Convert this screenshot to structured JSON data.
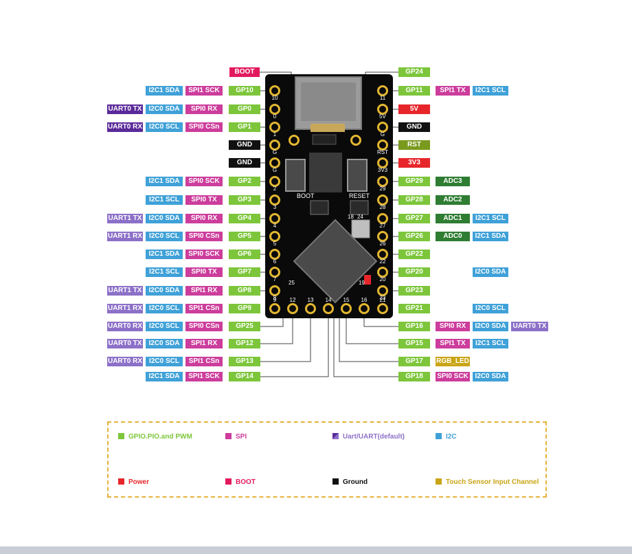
{
  "board": {
    "pad_numbers_left": [
      "10",
      "0",
      "1",
      "G",
      "G",
      "2",
      "3",
      "4",
      "5",
      "6",
      "7",
      "8"
    ],
    "pad_numbers_right": [
      "11",
      "5V",
      "G",
      "RST",
      "3V3",
      "29",
      "28",
      "27",
      "26",
      "22",
      "20",
      "23"
    ],
    "pad_numbers_bottom": [
      "9",
      "12",
      "13",
      "14",
      "15",
      "16",
      "21"
    ],
    "marks": {
      "boot": "BOOT",
      "reset": "RESET",
      "n18": "18",
      "n24": "24",
      "n25": "25",
      "n19": "19"
    }
  },
  "pins_left": [
    {
      "pin": "GP10",
      "tags": [
        {
          "t": "I2C1 SDA",
          "c": "i2c"
        },
        {
          "t": "SPI1 SCK",
          "c": "spi"
        }
      ]
    },
    {
      "pin": "GP0",
      "tags": [
        {
          "t": "UART0 TX",
          "c": "uart"
        },
        {
          "t": "I2C0 SDA",
          "c": "i2c"
        },
        {
          "t": "SPI0 RX",
          "c": "spi"
        }
      ]
    },
    {
      "pin": "GP1",
      "tags": [
        {
          "t": "UART0 RX",
          "c": "uart"
        },
        {
          "t": "I2C0 SCL",
          "c": "i2c"
        },
        {
          "t": "SPI0 CSn",
          "c": "spi"
        }
      ]
    },
    {
      "pin": "GND",
      "kind": "gnd",
      "tags": []
    },
    {
      "pin": "GND",
      "kind": "gnd",
      "tags": []
    },
    {
      "pin": "GP2",
      "tags": [
        {
          "t": "I2C1 SDA",
          "c": "i2c"
        },
        {
          "t": "SPI0 SCK",
          "c": "spi"
        }
      ]
    },
    {
      "pin": "GP3",
      "tags": [
        {
          "t": "I2C1 SCL",
          "c": "i2c"
        },
        {
          "t": "SPI0 TX",
          "c": "spi"
        }
      ]
    },
    {
      "pin": "GP4",
      "tags": [
        {
          "t": "UART1 TX",
          "c": "uartl"
        },
        {
          "t": "I2C0 SDA",
          "c": "i2c"
        },
        {
          "t": "SPI0 RX",
          "c": "spi"
        }
      ]
    },
    {
      "pin": "GP5",
      "tags": [
        {
          "t": "UART1 RX",
          "c": "uartl"
        },
        {
          "t": "I2C0 SCL",
          "c": "i2c"
        },
        {
          "t": "SPI0 CSn",
          "c": "spi"
        }
      ]
    },
    {
      "pin": "GP6",
      "tags": [
        {
          "t": "I2C1 SDA",
          "c": "i2c"
        },
        {
          "t": "SPI0 SCK",
          "c": "spi"
        }
      ]
    },
    {
      "pin": "GP7",
      "tags": [
        {
          "t": "I2C1 SCL",
          "c": "i2c"
        },
        {
          "t": "SPI0 TX",
          "c": "spi"
        }
      ]
    },
    {
      "pin": "GP8",
      "tags": [
        {
          "t": "UART1 TX",
          "c": "uartl"
        },
        {
          "t": "I2C0 SDA",
          "c": "i2c"
        },
        {
          "t": "SPI1 RX",
          "c": "spi"
        }
      ]
    },
    {
      "pin": "GP9",
      "tags": [
        {
          "t": "UART1 RX",
          "c": "uartl"
        },
        {
          "t": "I2C0 SCL",
          "c": "i2c"
        },
        {
          "t": "SPI1 CSn",
          "c": "spi"
        }
      ]
    },
    {
      "pin": "GP25",
      "tags": [
        {
          "t": "UART0 RX",
          "c": "uartl"
        },
        {
          "t": "I2C0 SCL",
          "c": "i2c"
        },
        {
          "t": "SPI0 CSn",
          "c": "spi"
        }
      ]
    },
    {
      "pin": "GP12",
      "tags": [
        {
          "t": "UART0 TX",
          "c": "uartl"
        },
        {
          "t": "I2C0 SDA",
          "c": "i2c"
        },
        {
          "t": "SPI1 RX",
          "c": "spi"
        }
      ]
    },
    {
      "pin": "GP13",
      "tags": [
        {
          "t": "UART0 RX",
          "c": "uartl"
        },
        {
          "t": "I2C0 SCL",
          "c": "i2c"
        },
        {
          "t": "SPI1 CSn",
          "c": "spi"
        }
      ]
    },
    {
      "pin": "GP14",
      "tags": [
        {
          "t": "I2C1 SDA",
          "c": "i2c"
        },
        {
          "t": "SPI1 SCK",
          "c": "spi"
        }
      ]
    }
  ],
  "pins_right": [
    {
      "pin": "GP24",
      "tags": []
    },
    {
      "pin": "GP11",
      "tags": [
        {
          "t": "SPI1 TX",
          "c": "spi"
        },
        {
          "t": "I2C1 SCL",
          "c": "i2c"
        }
      ]
    },
    {
      "pin": "5V",
      "kind": "power",
      "tags": []
    },
    {
      "pin": "GND",
      "kind": "gnd",
      "tags": []
    },
    {
      "pin": "RST",
      "kind": "rst",
      "tags": []
    },
    {
      "pin": "3V3",
      "kind": "power",
      "tags": []
    },
    {
      "pin": "GP29",
      "tags": [
        {
          "t": "ADC3",
          "c": "adc"
        }
      ]
    },
    {
      "pin": "GP28",
      "tags": [
        {
          "t": "ADC2",
          "c": "adc"
        }
      ]
    },
    {
      "pin": "GP27",
      "tags": [
        {
          "t": "ADC1",
          "c": "adc"
        },
        {
          "t": "I2C1 SCL",
          "c": "i2c"
        }
      ]
    },
    {
      "pin": "GP26",
      "tags": [
        {
          "t": "ADC0",
          "c": "adc"
        },
        {
          "t": "I2C1 SDA",
          "c": "i2c"
        }
      ]
    },
    {
      "pin": "GP22",
      "tags": []
    },
    {
      "pin": "GP20",
      "tags": [
        {
          "t": "",
          "c": "none"
        },
        {
          "t": "I2C0 SDA",
          "c": "i2c"
        }
      ]
    },
    {
      "pin": "GP23",
      "tags": []
    },
    {
      "pin": "GP21",
      "tags": [
        {
          "t": "",
          "c": "none"
        },
        {
          "t": "I2C0 SCL",
          "c": "i2c"
        }
      ]
    },
    {
      "pin": "GP16",
      "tags": [
        {
          "t": "SPI0 RX",
          "c": "spi"
        },
        {
          "t": "I2C0 SDA",
          "c": "i2c"
        },
        {
          "t": "UART0 TX",
          "c": "uartl"
        }
      ]
    },
    {
      "pin": "GP15",
      "tags": [
        {
          "t": "SPI1 TX",
          "c": "spi"
        },
        {
          "t": "I2C1 SCL",
          "c": "i2c"
        }
      ]
    },
    {
      "pin": "GP17",
      "tags": [
        {
          "t": "RGB_LED",
          "c": "rgb"
        }
      ]
    },
    {
      "pin": "GP18",
      "tags": [
        {
          "t": "SPI0 SCK",
          "c": "spi"
        },
        {
          "t": "I2C0 SDA",
          "c": "i2c"
        }
      ]
    }
  ],
  "boot_label": "BOOT",
  "legend": [
    {
      "text": "GPIO.PIO.and PWM",
      "color": "#7dc63b"
    },
    {
      "text": "SPI",
      "color": "#cc3d9c"
    },
    {
      "text": "Uart/UART(default)",
      "color": "#8c70c8"
    },
    {
      "text": "I2C",
      "color": "#3fa1d8"
    },
    {
      "text": "Power",
      "color": "#e7262b"
    },
    {
      "text": "BOOT",
      "color": "#e3195f"
    },
    {
      "text": "Ground",
      "color": "#111111"
    },
    {
      "text": "Touch Sensor Input Channel",
      "color": "#c9a516"
    }
  ]
}
